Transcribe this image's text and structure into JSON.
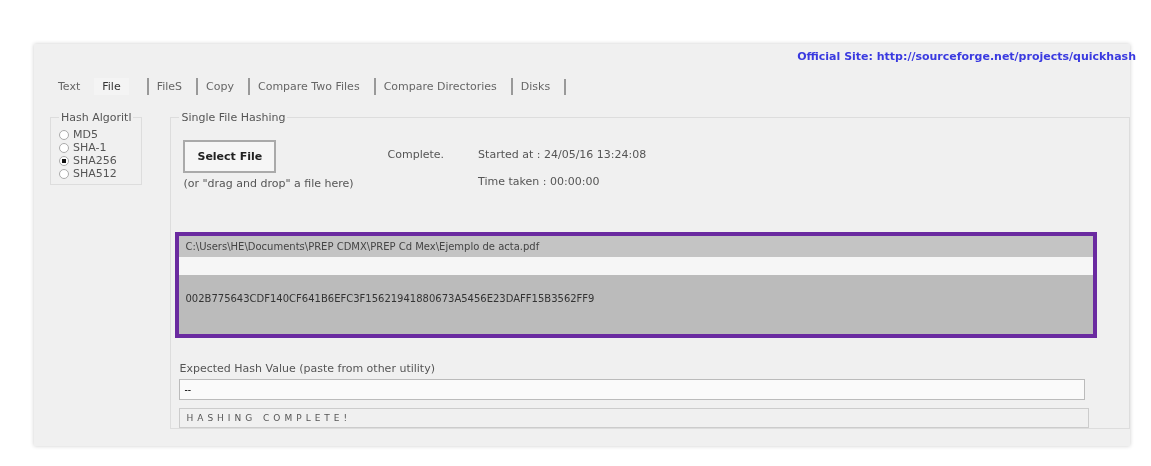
{
  "link": "Official Site: http://sourceforge.net/projects/quickhash",
  "tabs": [
    {
      "label": "Text",
      "selected": false,
      "divider": false
    },
    {
      "label": "File",
      "selected": true,
      "divider": false
    },
    {
      "label": "FileS",
      "selected": false,
      "divider": true
    },
    {
      "label": "Copy",
      "selected": false,
      "divider": true
    },
    {
      "label": "Compare Two Files",
      "selected": false,
      "divider": true
    },
    {
      "label": "Compare Directories",
      "selected": false,
      "divider": true
    },
    {
      "label": "Disks",
      "selected": false,
      "divider": true
    }
  ],
  "algorithms": {
    "title": "Hash Algoritl",
    "options": [
      {
        "label": "MD5",
        "selected": false
      },
      {
        "label": "SHA-1",
        "selected": false
      },
      {
        "label": "SHA256",
        "selected": true
      },
      {
        "label": "SHA512",
        "selected": false
      }
    ]
  },
  "single": {
    "title": "Single File Hashing",
    "button": "Select File",
    "status": "Complete.",
    "started": "Started at : 24/05/16 13:24:08",
    "taken": "Time taken : 00:00:00",
    "hint": "(or \"drag and drop\" a file here)",
    "path": "C:\\Users\\HE\\Documents\\PREP CDMX\\PREP Cd Mex\\Ejemplo de acta.pdf",
    "hash": "002B775643CDF140CF641B6EFC3F156219418806​73A5456E23DAFF15B3562FF9",
    "expected_label": "Expected Hash Value (paste from other utility)",
    "expected_value": "--",
    "status_bar": "HASHING COMPLETE!"
  }
}
